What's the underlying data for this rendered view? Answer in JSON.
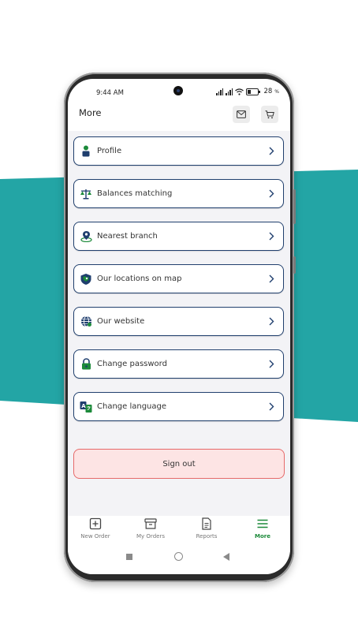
{
  "status_bar": {
    "time": "9:44 AM",
    "battery": "28"
  },
  "header": {
    "title": "More",
    "icons": [
      "mail-icon",
      "cart-icon"
    ]
  },
  "menu": {
    "items": [
      {
        "label": "Profile",
        "icon": "person-icon"
      },
      {
        "label": "Balances matching",
        "icon": "scales-icon"
      },
      {
        "label": "Nearest branch",
        "icon": "location-pin-icon"
      },
      {
        "label": "Our locations on map",
        "icon": "map-shield-icon"
      },
      {
        "label": "Our website",
        "icon": "globe-icon"
      },
      {
        "label": "Change password",
        "icon": "lock-icon"
      },
      {
        "label": "Change language",
        "icon": "translate-icon"
      }
    ],
    "signout_label": "Sign out"
  },
  "bottom_nav": {
    "items": [
      {
        "label": "New Order",
        "icon": "plus-square-icon",
        "active": false
      },
      {
        "label": "My Orders",
        "icon": "archive-box-icon",
        "active": false
      },
      {
        "label": "Reports",
        "icon": "document-icon",
        "active": false
      },
      {
        "label": "More",
        "icon": "hamburger-menu-icon",
        "active": true
      }
    ]
  },
  "colors": {
    "teal_band": "#23a5a5",
    "item_border": "#21406e",
    "accent_green": "#1c8a3a",
    "signout_bg": "#fde4e4",
    "signout_border": "#e66a6a"
  }
}
